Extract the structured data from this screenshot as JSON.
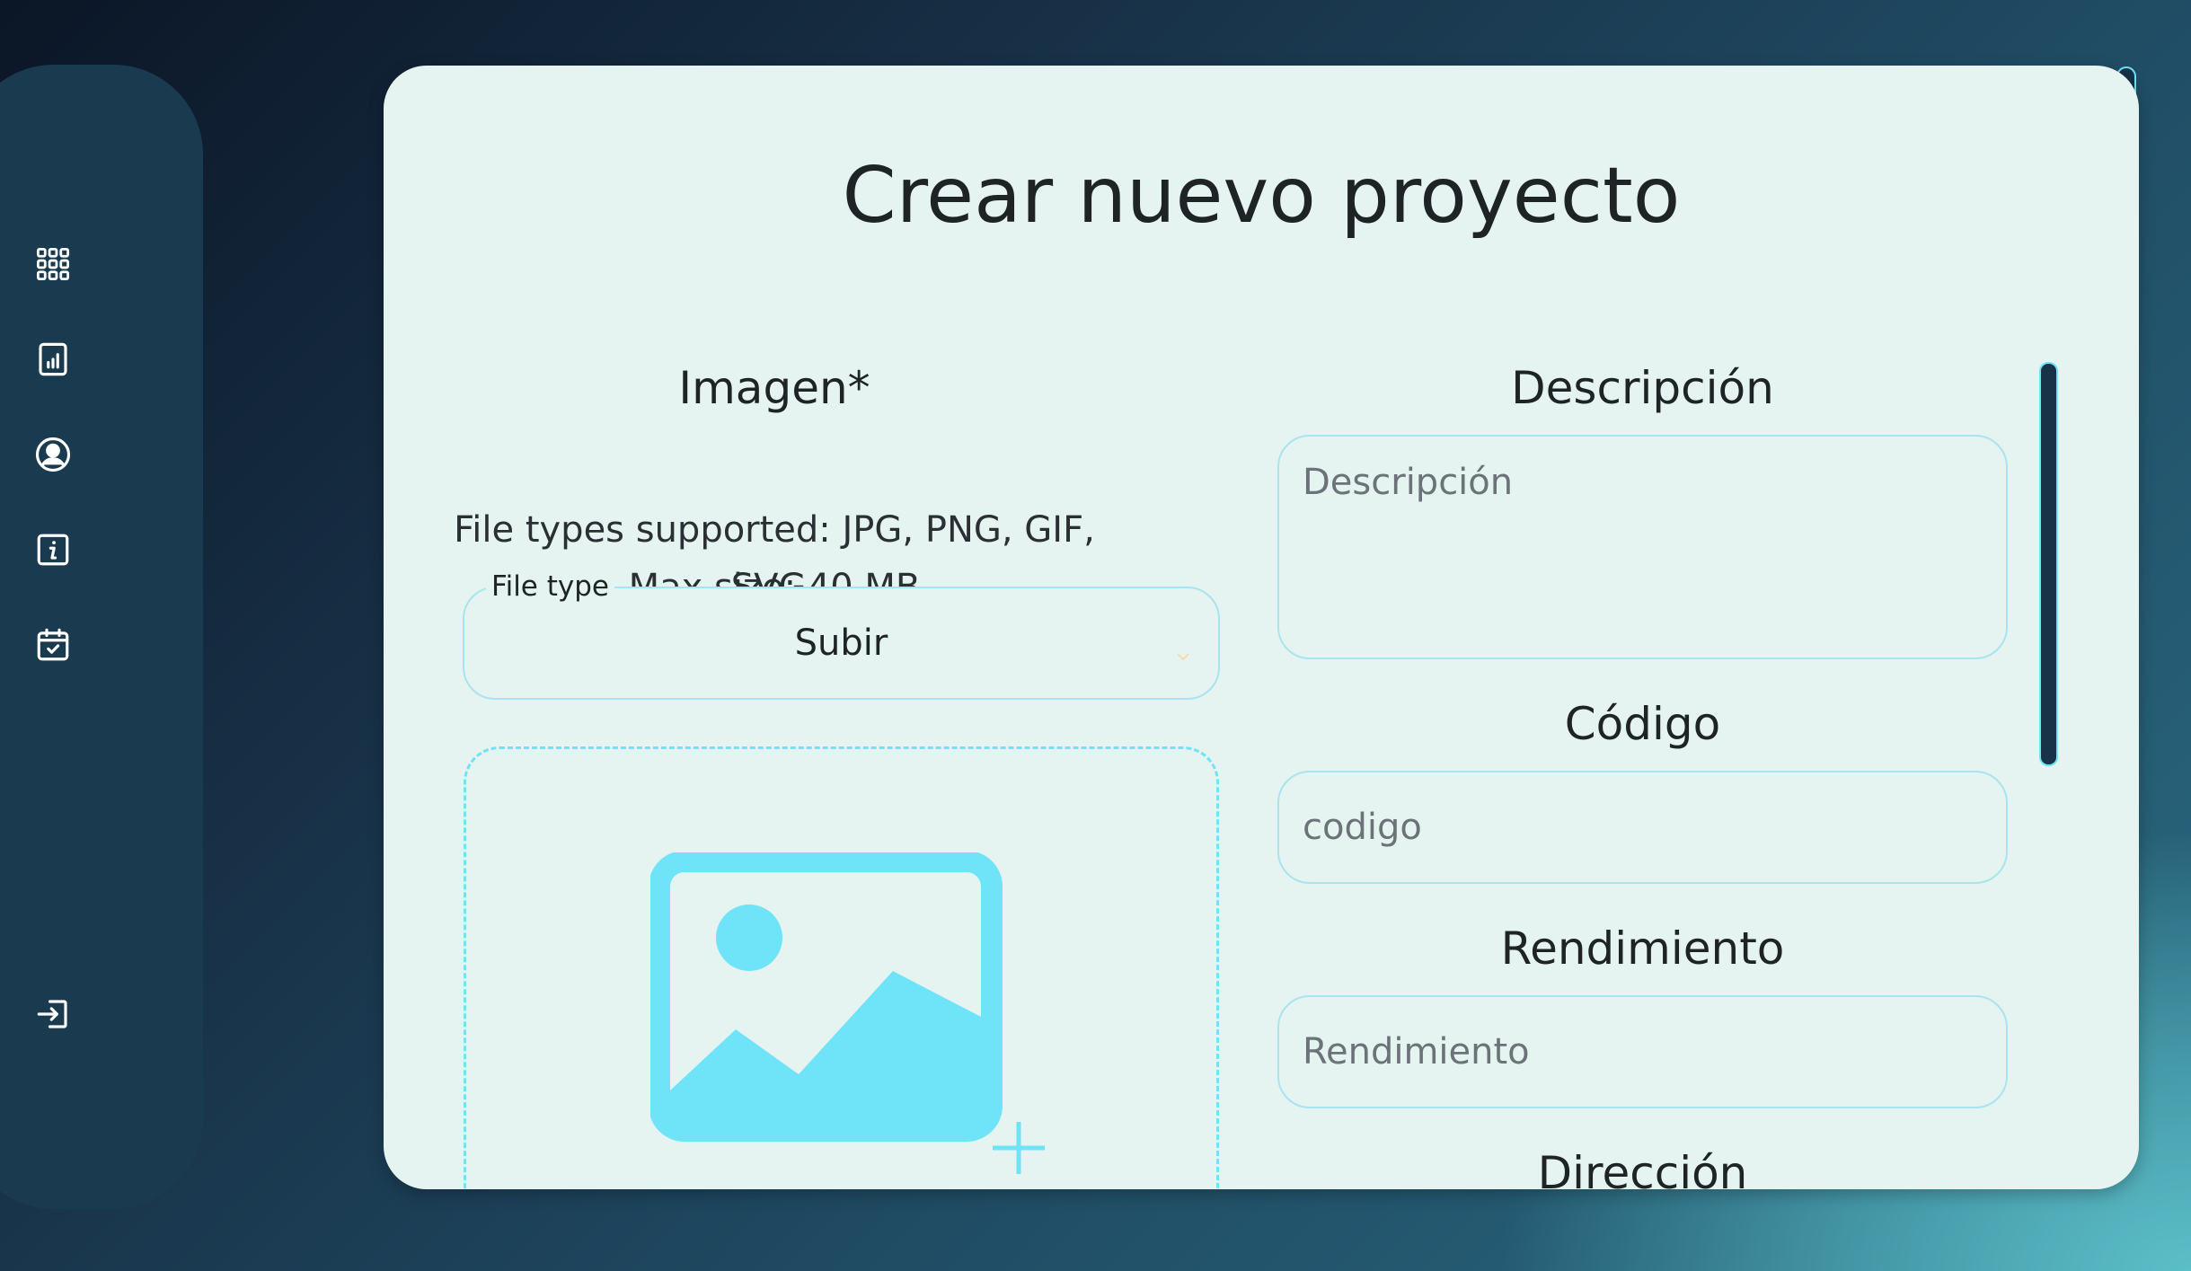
{
  "sidebar": {
    "items": [
      {
        "icon": "grid-icon"
      },
      {
        "icon": "chart-icon"
      },
      {
        "icon": "user-icon"
      },
      {
        "icon": "info-icon"
      },
      {
        "icon": "calendar-check-icon"
      },
      {
        "icon": "logout-icon"
      }
    ]
  },
  "form": {
    "title": "Crear nuevo proyecto",
    "image": {
      "label": "Imagen*",
      "help_line1": "File types supported: JPG, PNG, GIF, SVG,",
      "help_line2": "Max size: 40 MB",
      "file_type_label": "File type",
      "file_type_value": "Subir"
    },
    "description": {
      "label": "Descripción",
      "placeholder": "Descripción"
    },
    "code": {
      "label": "Código",
      "placeholder": "codigo"
    },
    "performance": {
      "label": "Rendimiento",
      "placeholder": "Rendimiento"
    },
    "address": {
      "label": "Dirección"
    }
  },
  "colors": {
    "accent": "#6fe3f7",
    "card_bg": "#e6f4f1",
    "sidebar_bg": "#1a3a4f",
    "border": "#a9e4ee"
  }
}
